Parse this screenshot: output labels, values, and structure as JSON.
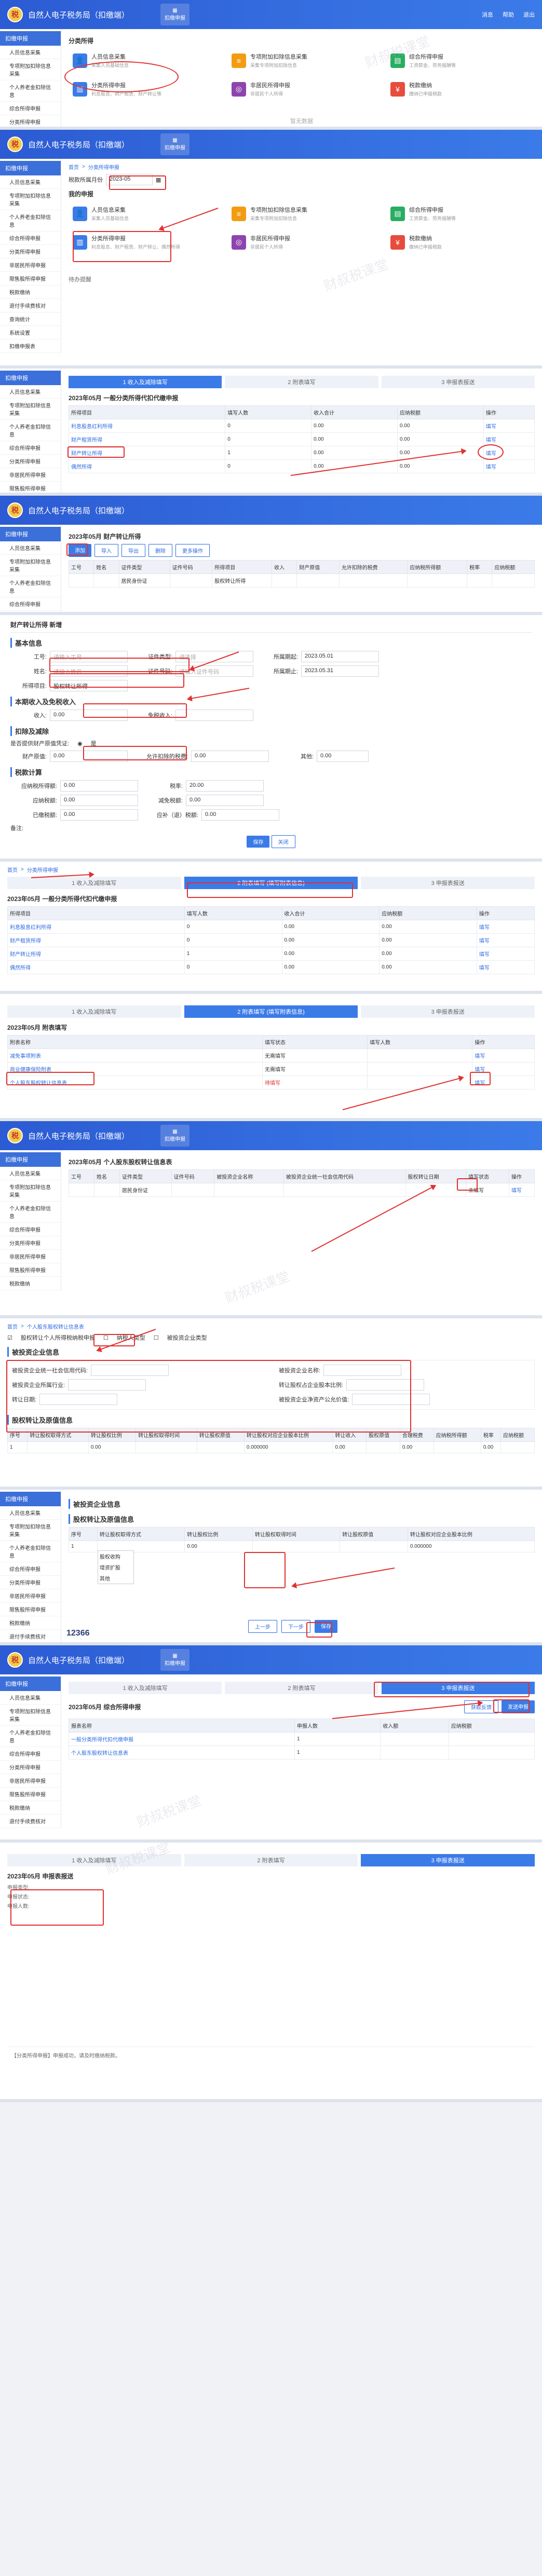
{
  "app": {
    "title": "自然人电子税务局（扣缴端）",
    "tab_label": "扣缴申报",
    "logo": "税",
    "top_right": [
      "消息",
      "帮助",
      "退出"
    ],
    "watermark": "财叔税课堂"
  },
  "sidebar": {
    "head": "扣缴申报",
    "items": [
      "人员信息采集",
      "专项附加扣除信息采集",
      "个人养老金扣除信息",
      "综合所得申报",
      "分类所得申报",
      "非居民所得申报",
      "限售股所得申报",
      "税款缴纳",
      "退付手续费核对",
      "查询统计",
      "系统设置",
      "扣缴申报表"
    ]
  },
  "p1": {
    "section": "分类所得",
    "cards": [
      {
        "title": "人员信息采集",
        "desc": "采集人员基础信息"
      },
      {
        "title": "专项附加扣除信息采集",
        "desc": "采集专项附加扣除信息"
      },
      {
        "title": "综合所得申报",
        "desc": "工资薪金、劳务报酬等"
      },
      {
        "title": "分类所得申报",
        "desc": "利息股息、财产租赁、财产转让等"
      },
      {
        "title": "非居民所得申报",
        "desc": "非居民个人所得"
      },
      {
        "title": "税款缴纳",
        "desc": "缴纳已申报税款"
      }
    ],
    "empty": "暂无数据"
  },
  "p2": {
    "crumb": [
      "首页",
      "分类所得申报"
    ],
    "period_label": "税款所属月份",
    "period": "2023-05",
    "section": "我的申报",
    "cards": [
      {
        "title": "人员信息采集",
        "desc": "采集人员基础信息"
      },
      {
        "title": "专项附加扣除信息采集",
        "desc": "采集专项附加扣除信息"
      },
      {
        "title": "综合所得申报",
        "desc": "工资薪金、劳务报酬等"
      },
      {
        "title": "分类所得申报",
        "desc": "利息股息、财产租赁、财产转让、偶然所得"
      },
      {
        "title": "非居民所得申报",
        "desc": "非居民个人所得"
      },
      {
        "title": "税款缴纳",
        "desc": "缴纳已申报税款"
      }
    ],
    "bottom": "待办提醒"
  },
  "p3": {
    "steps": [
      "1 收入及减除填写",
      "2 附表填写",
      "3 申报表报送"
    ],
    "heading": "2023年05月 一般分类所得代扣代缴申报",
    "columns": [
      "所得项目",
      "填写人数",
      "收入合计",
      "应纳税额",
      "操作"
    ],
    "rows": [
      [
        "利息股息红利所得",
        "0",
        "0.00",
        "0.00",
        "填写"
      ],
      [
        "财产租赁所得",
        "0",
        "0.00",
        "0.00",
        "填写"
      ],
      [
        "财产转让所得",
        "1",
        "0.00",
        "0.00",
        "填写"
      ],
      [
        "偶然所得",
        "0",
        "0.00",
        "0.00",
        "填写"
      ]
    ]
  },
  "p4": {
    "heading": "2023年05月 财产转让所得",
    "toolbar": [
      "添加",
      "导入",
      "导出",
      "删除",
      "更多操作"
    ],
    "columns": [
      "工号",
      "姓名",
      "证件类型",
      "证件号码",
      "所得项目",
      "收入",
      "财产原值",
      "允许扣除的税费",
      "应纳税所得额",
      "税率",
      "应纳税额"
    ],
    "row": [
      "",
      "",
      "居民身份证",
      "",
      "股权转让所得",
      "",
      "",
      "",
      "",
      "",
      ""
    ]
  },
  "dialog": {
    "title": "财产转让所得 新增",
    "basic": "基本信息",
    "fields1": [
      {
        "label": "工号:",
        "value": "请输入工号"
      },
      {
        "label": "证件类型:",
        "value": "请选择"
      },
      {
        "label": "所属期起:",
        "value": "2023.05.01"
      }
    ],
    "fields2": [
      {
        "label": "姓名:",
        "value": "请输入姓名"
      },
      {
        "label": "证件号码:",
        "value": "请输入证件号码"
      },
      {
        "label": "所属期止:",
        "value": "2023.05.31"
      }
    ],
    "item_label": "所得项目:",
    "item_value": "股权转让所得",
    "income_h": "本期收入及免税收入",
    "income_label": "收入:",
    "income_value": "0.00",
    "exempt_label": "免税收入:",
    "exempt_value": "",
    "deduct_h": "扣除及减除",
    "deduct_q": "是否提供财产原值凭证:",
    "deduct_a": "是",
    "original_label": "财产原值:",
    "original_value": "0.00",
    "tax_label": "允许扣除的税费:",
    "tax_value": "0.00",
    "other_label": "其他:",
    "other_value": "0.00",
    "calc_h": "税款计算",
    "calc_fields": [
      {
        "label": "应纳税所得额:",
        "value": "0.00"
      },
      {
        "label": "税率:",
        "value": "20.00"
      },
      {
        "label": "应纳税额:",
        "value": "0.00"
      },
      {
        "label": "减免税额:",
        "value": "0.00"
      },
      {
        "label": "已缴税额:",
        "value": "0.00"
      },
      {
        "label": "应补（退）税额:",
        "value": "0.00"
      }
    ],
    "remark": "备注:",
    "save": "保存",
    "close": "关闭"
  },
  "p5": {
    "crumb": [
      "首页",
      "分类所得申报"
    ],
    "steps": [
      "1 收入及减除填写",
      "2 附表填写 (填写附表信息)",
      "3 申报表报送"
    ],
    "heading": "2023年05月 一般分类所得代扣代缴申报",
    "rows": [
      [
        "利息股息红利所得",
        "0",
        "0.00",
        "0.00",
        "填写"
      ],
      [
        "财产租赁所得",
        "0",
        "0.00",
        "0.00",
        "填写"
      ],
      [
        "财产转让所得",
        "1",
        "0.00",
        "0.00",
        "填写"
      ],
      [
        "偶然所得",
        "0",
        "0.00",
        "0.00",
        "填写"
      ]
    ]
  },
  "p6": {
    "steps": [
      "1 收入及减除填写",
      "2 附表填写 (填写附表信息)",
      "3 申报表报送"
    ],
    "heading": "2023年05月 附表填写",
    "columns": [
      "附表名称",
      "填写状态",
      "填写人数",
      "操作"
    ],
    "rows": [
      [
        "减免事项附表",
        "无需填写",
        "",
        "填写"
      ],
      [
        "商业健康保险附表",
        "无需填写",
        "",
        "填写"
      ],
      [
        "个人股东股权转让信息表",
        "待填写",
        "",
        "填写"
      ]
    ]
  },
  "p7": {
    "heading": "2023年05月 个人股东股权转让信息表",
    "columns": [
      "工号",
      "姓名",
      "证件类型",
      "证件号码",
      "被投资企业名称",
      "被投资企业统一社会信用代码",
      "股权转让日期",
      "填写状态",
      "操作"
    ],
    "row": [
      "",
      "",
      "居民身份证",
      "",
      "",
      "",
      "",
      "未填写",
      "填写"
    ]
  },
  "p8": {
    "crumb": [
      "首页",
      "个人股东股权转让信息表"
    ],
    "opts": [
      "股权转让个人所得税纳税申报",
      "纳税人类型",
      "被投资企业类型"
    ],
    "section1": "被投资企业信息",
    "fields": [
      "被投资企业统一社会信用代码:",
      "被投资企业名称:",
      "被投资企业所属行业:",
      "转让股权占企业股本比例:",
      "转让日期:",
      "被投资企业净资产公允价值:"
    ],
    "section2": "股权转让及原值信息",
    "columns": [
      "序号",
      "转让股权取得方式",
      "转让股权比例",
      "转让股权取得时间",
      "转让股权原值",
      "转让股权对应企业股本比例",
      "转让收入",
      "股权原值",
      "合理税费",
      "应纳税所得额",
      "税率",
      "应纳税额"
    ],
    "row": [
      "1",
      "",
      "0.00",
      "",
      "",
      "0.000000",
      "0.00",
      "",
      "0.00",
      "",
      "0.00",
      ""
    ]
  },
  "p9": {
    "menu": [
      "股权收购",
      "增资扩股",
      "其他"
    ],
    "btn_prev": "上一步",
    "btn_next": "下一步",
    "btn_save": "保存"
  },
  "p10": {
    "steps": [
      "1 收入及减除填写",
      "2 附表填写",
      "3 申报表报送"
    ],
    "heading": "2023年05月 综合所得申报",
    "buttons": [
      "获取反馈",
      "发送申报"
    ],
    "columns": [
      "报表名称",
      "申报人数",
      "收入额",
      "应纳税额"
    ],
    "rows": [
      [
        "一般分类所得代扣代缴申报",
        "1",
        "",
        ""
      ],
      [
        "个人股东股权转让信息表",
        "1",
        "",
        ""
      ]
    ]
  },
  "p11": {
    "steps": [
      "1 收入及减除填写",
      "2 附表填写",
      "3 申报表报送"
    ],
    "heading": "2023年05月 申报表报送",
    "lines": [
      "申报类型:",
      "申报状态:",
      "申报人数:"
    ],
    "note": "【分类所得申报】申报成功，请及时缴纳税款。",
    "phone": "12366"
  }
}
